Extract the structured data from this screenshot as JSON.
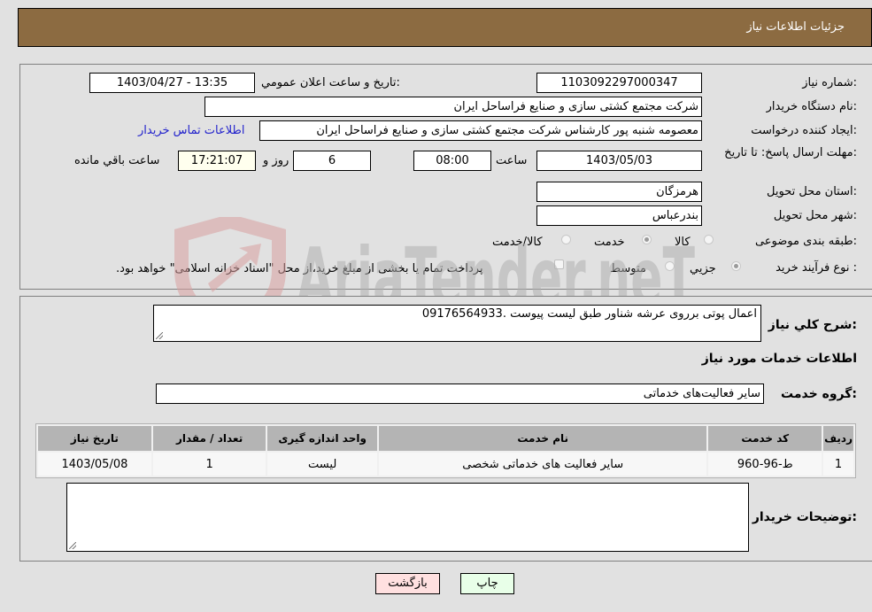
{
  "header": {
    "title": "جزئیات اطلاعات نیاز"
  },
  "fields": {
    "need_number": {
      "label": "شماره نیاز:",
      "value": "1103092297000347"
    },
    "announce_datetime": {
      "label": "تاریخ و ساعت اعلان عمومي:",
      "value": "1403/04/27 - 13:35"
    },
    "buyer_org": {
      "label": "نام دستگاه خریدار:",
      "value": "شرکت مجتمع کشتی سازی و صنایع فراساحل ایران"
    },
    "requester": {
      "label": "ایجاد کننده درخواست:",
      "value": "معصومه شنبه پور کارشناس شرکت مجتمع کشتی سازی و صنایع فراساحل ایران",
      "contact_link": "اطلاعات تماس خریدار"
    },
    "deadline": {
      "label": "مهلت ارسال پاسخ: تا تاریخ:",
      "date": "1403/05/03",
      "time_label": "ساعت",
      "time": "08:00",
      "days": "6",
      "days_label": "روز و",
      "remaining": "17:21:07",
      "remaining_label": "ساعت باقي مانده"
    },
    "province": {
      "label": "استان محل تحویل:",
      "value": "هرمزگان"
    },
    "city": {
      "label": "شهر محل تحویل:",
      "value": "بندرعباس"
    },
    "category": {
      "label": "طبقه بندی موضوعی:",
      "options": [
        "کالا",
        "خدمت",
        "کالا/خدمت"
      ],
      "selected": "خدمت"
    },
    "purchase_type": {
      "label": "نوع فرآیند خرید :",
      "options": [
        "جزيي",
        "متوسط"
      ],
      "selected": "جزيي",
      "treasury_note": "پرداخت تمام یا بخشی از مبلغ خرید،از محل \"اسناد خزانه اسلامی\" خواهد بود."
    }
  },
  "description": {
    "label": "شرح كلي نیاز:",
    "value": "اعمال پوتی برروی عرشه شناور طبق لیست پیوست .09176564933"
  },
  "services_section": {
    "title": "اطلاعات خدمات مورد نیاز"
  },
  "service_group": {
    "label": "گروه خدمت:",
    "value": "سایر فعالیت‌های خدماتی"
  },
  "table": {
    "headers": [
      "ردیف",
      "کد خدمت",
      "نام خدمت",
      "واحد اندازه گیری",
      "تعداد / مقدار",
      "تاریخ نیاز"
    ],
    "rows": [
      [
        "1",
        "ط-96-960",
        "سایر فعالیت های خدماتی شخصی",
        "لیست",
        "1",
        "1403/05/08"
      ]
    ]
  },
  "buyer_notes": {
    "label": "توضیحات خریدار:",
    "value": ""
  },
  "buttons": {
    "print": "چاپ",
    "back": "بازگشت"
  },
  "watermark": {
    "text": "AriaTender.neT"
  }
}
